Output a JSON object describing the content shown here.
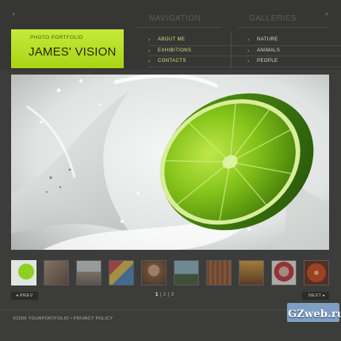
{
  "header": {
    "navigation_heading": "NAVIGATION",
    "galleries_heading": "GALLERIES"
  },
  "logo": {
    "subtitle": "PHOTO PORTFOLIO",
    "title": "JAMES' VISION",
    "color": "#b6de24"
  },
  "navigation": {
    "items": [
      {
        "label": "ABOUT ME"
      },
      {
        "label": "EXHIBITIONS"
      },
      {
        "label": "CONTACTS"
      }
    ]
  },
  "galleries": {
    "items": [
      {
        "label": "NATURE"
      },
      {
        "label": "ANIMALS"
      },
      {
        "label": "PEOPLE"
      }
    ]
  },
  "main_image": {
    "subject": "lime slice splashing in water",
    "accent": "#7cc414"
  },
  "thumbnails": [
    {
      "subject": "lime",
      "active": true
    },
    {
      "subject": "portrait"
    },
    {
      "subject": "architecture"
    },
    {
      "subject": "kite"
    },
    {
      "subject": "woman"
    },
    {
      "subject": "palm-tree"
    },
    {
      "subject": "texture"
    },
    {
      "subject": "sunset"
    },
    {
      "subject": "child"
    },
    {
      "subject": "flower"
    },
    {
      "subject": "tool"
    }
  ],
  "pager": {
    "prev_label": "PREV",
    "next_label": "NEXT",
    "pages": [
      "1",
      "2",
      "3"
    ],
    "current_page": "1"
  },
  "footer": {
    "copyright": "©2006 YOURPORTFOLIO",
    "separator": "•",
    "privacy": "PRIVACY POLICY"
  },
  "watermark": {
    "text": "GZweb.ru"
  }
}
